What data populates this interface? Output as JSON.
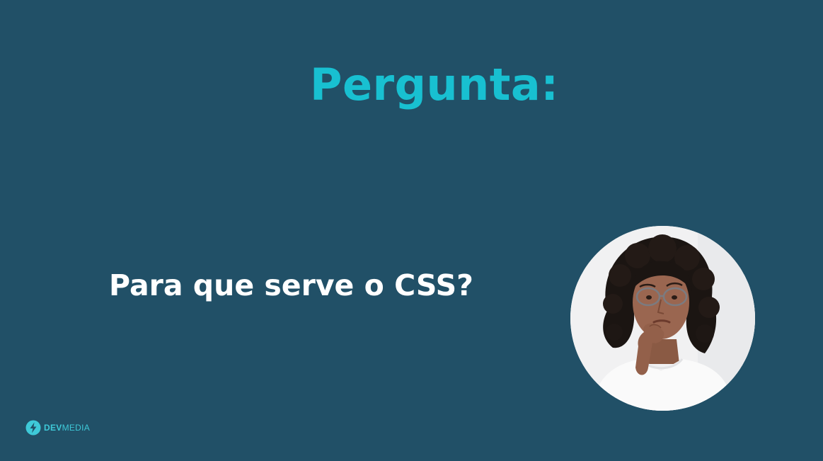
{
  "slide": {
    "title": "Pergunta:",
    "question": "Para que serve o CSS?"
  },
  "photo": {
    "subject": "pensive-woman-photo"
  },
  "brand": {
    "name_bold": "DEV",
    "name_light": "MEDIA",
    "logo_icon": "lightning-bolt-icon"
  },
  "colors": {
    "background": "#215067",
    "title": "#18c0d1",
    "question": "#ffffff",
    "brand": "#3ec9d8"
  }
}
